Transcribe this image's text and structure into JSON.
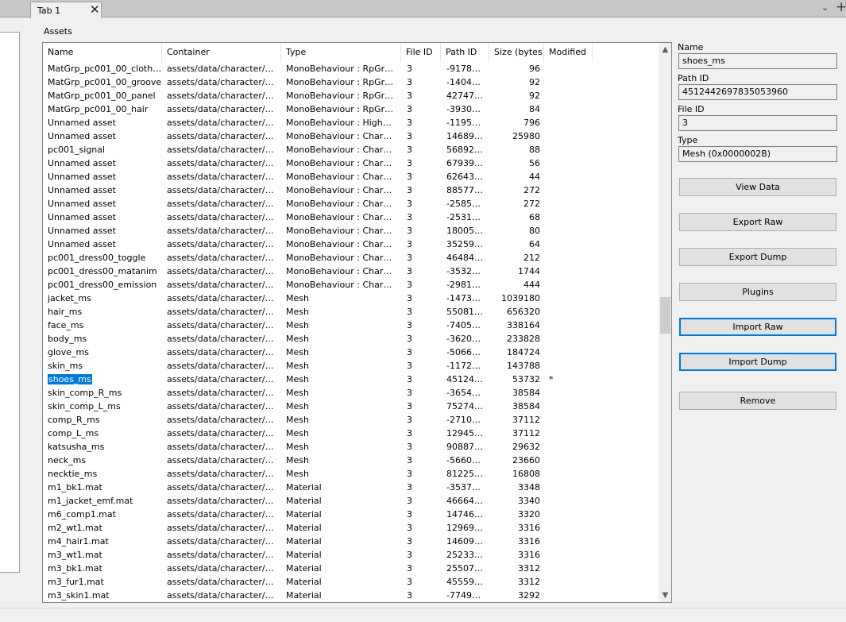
{
  "tabs": [
    {
      "label": "Tab 1",
      "close": "✕"
    }
  ],
  "window": {
    "menu_chevron": "⌄",
    "add_tab": "+"
  },
  "assets_label": "Assets",
  "columns": [
    "Name",
    "Container",
    "Type",
    "File ID",
    "Path ID",
    "Size (bytes)",
    "Modified"
  ],
  "rows": [
    {
      "name": "MatGrp_pc001_00_clothes",
      "container": "assets/data/character/pla...",
      "type": "MonoBehaviour : RpGraph...",
      "file_id": "3",
      "path_id": "-91788...",
      "size": "96",
      "modified": ""
    },
    {
      "name": "MatGrp_pc001_00_groove",
      "container": "assets/data/character/pla...",
      "type": "MonoBehaviour : RpGraph...",
      "file_id": "3",
      "path_id": "-14041...",
      "size": "92",
      "modified": ""
    },
    {
      "name": "MatGrp_pc001_00_panel",
      "container": "assets/data/character/pla...",
      "type": "MonoBehaviour : RpGraph...",
      "file_id": "3",
      "path_id": "427475...",
      "size": "92",
      "modified": ""
    },
    {
      "name": "MatGrp_pc001_00_hair",
      "container": "assets/data/character/pla...",
      "type": "MonoBehaviour : RpGraph...",
      "file_id": "3",
      "path_id": "-39302...",
      "size": "84",
      "modified": ""
    },
    {
      "name": "Unnamed asset",
      "container": "assets/data/character/pla...",
      "type": "MonoBehaviour : HighCha...",
      "file_id": "3",
      "path_id": "-11955...",
      "size": "796",
      "modified": ""
    },
    {
      "name": "Unnamed asset",
      "container": "assets/data/character/pla...",
      "type": "MonoBehaviour : Charact...",
      "file_id": "3",
      "path_id": "146893...",
      "size": "25980",
      "modified": ""
    },
    {
      "name": "pc001_signal",
      "container": "assets/data/character/pla...",
      "type": "MonoBehaviour : Charact...",
      "file_id": "3",
      "path_id": "568928...",
      "size": "88",
      "modified": ""
    },
    {
      "name": "Unnamed asset",
      "container": "assets/data/character/pla...",
      "type": "MonoBehaviour : Charact...",
      "file_id": "3",
      "path_id": "679395...",
      "size": "56",
      "modified": ""
    },
    {
      "name": "Unnamed asset",
      "container": "assets/data/character/pla...",
      "type": "MonoBehaviour : Charact...",
      "file_id": "3",
      "path_id": "626435...",
      "size": "44",
      "modified": ""
    },
    {
      "name": "Unnamed asset",
      "container": "assets/data/character/pla...",
      "type": "MonoBehaviour : Charact...",
      "file_id": "3",
      "path_id": "885774...",
      "size": "272",
      "modified": ""
    },
    {
      "name": "Unnamed asset",
      "container": "assets/data/character/pla...",
      "type": "MonoBehaviour : Charact...",
      "file_id": "3",
      "path_id": "-25852...",
      "size": "272",
      "modified": ""
    },
    {
      "name": "Unnamed asset",
      "container": "assets/data/character/pla...",
      "type": "MonoBehaviour : Chara.C...",
      "file_id": "3",
      "path_id": "-25313...",
      "size": "68",
      "modified": ""
    },
    {
      "name": "Unnamed asset",
      "container": "assets/data/character/pla...",
      "type": "MonoBehaviour : Chara.C...",
      "file_id": "3",
      "path_id": "180053...",
      "size": "80",
      "modified": ""
    },
    {
      "name": "Unnamed asset",
      "container": "assets/data/character/pla...",
      "type": "MonoBehaviour : Chara.C...",
      "file_id": "3",
      "path_id": "352593...",
      "size": "64",
      "modified": ""
    },
    {
      "name": "pc001_dress00_toggle",
      "container": "assets/data/character/pla...",
      "type": "MonoBehaviour : Chara.C...",
      "file_id": "3",
      "path_id": "464840...",
      "size": "212",
      "modified": ""
    },
    {
      "name": "pc001_dress00_matanim",
      "container": "assets/data/character/pla...",
      "type": "MonoBehaviour : Chara.C...",
      "file_id": "3",
      "path_id": "-35321...",
      "size": "1744",
      "modified": ""
    },
    {
      "name": "pc001_dress00_emission",
      "container": "assets/data/character/pla...",
      "type": "MonoBehaviour : Chara.C...",
      "file_id": "3",
      "path_id": "-29818...",
      "size": "444",
      "modified": ""
    },
    {
      "name": "jacket_ms",
      "container": "assets/data/character/pla...",
      "type": "Mesh",
      "file_id": "3",
      "path_id": "-14731...",
      "size": "1039180",
      "modified": ""
    },
    {
      "name": "hair_ms",
      "container": "assets/data/character/pla...",
      "type": "Mesh",
      "file_id": "3",
      "path_id": "550817...",
      "size": "656320",
      "modified": ""
    },
    {
      "name": "face_ms",
      "container": "assets/data/character/pla...",
      "type": "Mesh",
      "file_id": "3",
      "path_id": "-74050...",
      "size": "338164",
      "modified": ""
    },
    {
      "name": "body_ms",
      "container": "assets/data/character/pla...",
      "type": "Mesh",
      "file_id": "3",
      "path_id": "-36206...",
      "size": "233828",
      "modified": ""
    },
    {
      "name": "glove_ms",
      "container": "assets/data/character/pla...",
      "type": "Mesh",
      "file_id": "3",
      "path_id": "-50666...",
      "size": "184724",
      "modified": ""
    },
    {
      "name": "skin_ms",
      "container": "assets/data/character/pla...",
      "type": "Mesh",
      "file_id": "3",
      "path_id": "-11729...",
      "size": "143788",
      "modified": ""
    },
    {
      "name": "shoes_ms",
      "container": "assets/data/character/pla...",
      "type": "Mesh",
      "file_id": "3",
      "path_id": "451244...",
      "size": "53732",
      "modified": "*",
      "selected": true
    },
    {
      "name": "skin_comp_R_ms",
      "container": "assets/data/character/pla...",
      "type": "Mesh",
      "file_id": "3",
      "path_id": "-36545...",
      "size": "38584",
      "modified": ""
    },
    {
      "name": "skin_comp_L_ms",
      "container": "assets/data/character/pla...",
      "type": "Mesh",
      "file_id": "3",
      "path_id": "752743...",
      "size": "38584",
      "modified": ""
    },
    {
      "name": "comp_R_ms",
      "container": "assets/data/character/pla...",
      "type": "Mesh",
      "file_id": "3",
      "path_id": "-27104...",
      "size": "37112",
      "modified": ""
    },
    {
      "name": "comp_L_ms",
      "container": "assets/data/character/pla...",
      "type": "Mesh",
      "file_id": "3",
      "path_id": "129452...",
      "size": "37112",
      "modified": ""
    },
    {
      "name": "katsusha_ms",
      "container": "assets/data/character/pla...",
      "type": "Mesh",
      "file_id": "3",
      "path_id": "908876...",
      "size": "29632",
      "modified": ""
    },
    {
      "name": "neck_ms",
      "container": "assets/data/character/pla...",
      "type": "Mesh",
      "file_id": "3",
      "path_id": "-56605...",
      "size": "23660",
      "modified": ""
    },
    {
      "name": "necktie_ms",
      "container": "assets/data/character/pla...",
      "type": "Mesh",
      "file_id": "3",
      "path_id": "812256...",
      "size": "16808",
      "modified": ""
    },
    {
      "name": "m1_bk1.mat",
      "container": "assets/data/character/pla...",
      "type": "Material",
      "file_id": "3",
      "path_id": "-35371...",
      "size": "3348",
      "modified": ""
    },
    {
      "name": "m1_jacket_emf.mat",
      "container": "assets/data/character/pla...",
      "type": "Material",
      "file_id": "3",
      "path_id": "466645...",
      "size": "3340",
      "modified": ""
    },
    {
      "name": "m6_comp1.mat",
      "container": "assets/data/character/pla...",
      "type": "Material",
      "file_id": "3",
      "path_id": "147468...",
      "size": "3320",
      "modified": ""
    },
    {
      "name": "m2_wt1.mat",
      "container": "assets/data/character/pla...",
      "type": "Material",
      "file_id": "3",
      "path_id": "129697...",
      "size": "3316",
      "modified": ""
    },
    {
      "name": "m4_hair1.mat",
      "container": "assets/data/character/pla...",
      "type": "Material",
      "file_id": "3",
      "path_id": "146098...",
      "size": "3316",
      "modified": ""
    },
    {
      "name": "m3_wt1.mat",
      "container": "assets/data/character/pla...",
      "type": "Material",
      "file_id": "3",
      "path_id": "252338...",
      "size": "3316",
      "modified": ""
    },
    {
      "name": "m3_bk1.mat",
      "container": "assets/data/character/pla...",
      "type": "Material",
      "file_id": "3",
      "path_id": "255071...",
      "size": "3312",
      "modified": ""
    },
    {
      "name": "m3_fur1.mat",
      "container": "assets/data/character/pla...",
      "type": "Material",
      "file_id": "3",
      "path_id": "455593...",
      "size": "3312",
      "modified": ""
    },
    {
      "name": "m3_skin1.mat",
      "container": "assets/data/character/pla...",
      "type": "Material",
      "file_id": "3",
      "path_id": "-77495...",
      "size": "3292",
      "modified": ""
    }
  ],
  "scrollbar": {
    "up": "▲",
    "down": "▼"
  },
  "details": {
    "name_label": "Name",
    "name_value": "shoes_ms",
    "path_id_label": "Path ID",
    "path_id_value": "4512442697835053960",
    "file_id_label": "File ID",
    "file_id_value": "3",
    "type_label": "Type",
    "type_value": "Mesh (0x0000002B)"
  },
  "buttons": {
    "view_data": "View Data",
    "export_raw": "Export Raw",
    "export_dump": "Export Dump",
    "plugins": "Plugins",
    "import_raw": "Import Raw",
    "import_dump": "Import Dump",
    "remove": "Remove"
  },
  "colors": {
    "selection": "#0078d7",
    "focus_border": "#0078d7"
  }
}
